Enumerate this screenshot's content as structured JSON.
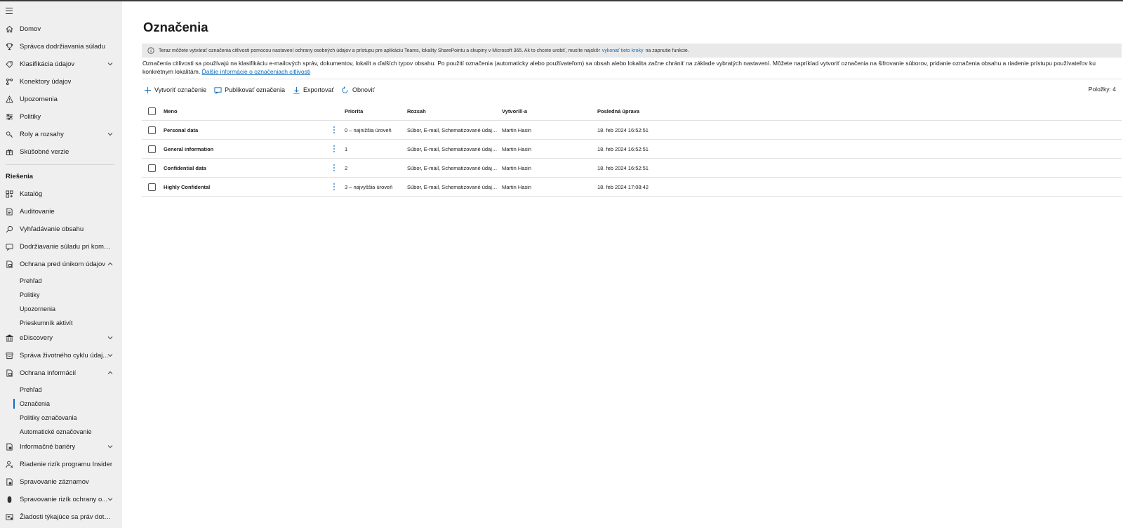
{
  "sidebar": {
    "items": [
      {
        "label": "Domov",
        "icon": "home-icon"
      },
      {
        "label": "Správca dodržiavania súladu",
        "icon": "trophy-icon"
      },
      {
        "label": "Klasifikácia údajov",
        "icon": "tag-icon",
        "expandable": true
      },
      {
        "label": "Konektory údajov",
        "icon": "connector-icon"
      },
      {
        "label": "Upozornenia",
        "icon": "warning-icon"
      },
      {
        "label": "Politiky",
        "icon": "sliders-icon"
      },
      {
        "label": "Roly a rozsahy",
        "icon": "key-icon",
        "expandable": true
      },
      {
        "label": "Skúšobné verzie",
        "icon": "gift-icon"
      }
    ],
    "section_title": "Riešenia",
    "solutions": [
      {
        "label": "Katalóg",
        "icon": "grid-icon"
      },
      {
        "label": "Auditovanie",
        "icon": "audit-icon"
      },
      {
        "label": "Vyhľadávanie obsahu",
        "icon": "search-icon"
      },
      {
        "label": "Dodržiavanie súladu pri komunik...",
        "icon": "chat-icon"
      },
      {
        "label": "Ochrana pred únikom údajov",
        "icon": "dlp-icon",
        "expanded": true,
        "children": [
          "Prehľad",
          "Politiky",
          "Upozornenia",
          "Prieskumník aktivít"
        ]
      },
      {
        "label": "eDiscovery",
        "icon": "building-icon",
        "expandable": true
      },
      {
        "label": "Správa životného cyklu údaj...",
        "icon": "archive-icon",
        "expandable": true
      },
      {
        "label": "Ochrana informácií",
        "icon": "lock-doc-icon",
        "expanded": true,
        "children": [
          "Prehľad",
          "Označenia",
          "Politiky označovania",
          "Automatické označovanie"
        ],
        "active_child": "Označenia"
      },
      {
        "label": "Informačné bariéry",
        "icon": "barrier-icon",
        "expandable": true
      },
      {
        "label": "Riadenie rizík programu Insider",
        "icon": "person-risk-icon"
      },
      {
        "label": "Spravovanie záznamov",
        "icon": "records-icon"
      },
      {
        "label": "Spravovanie rizík ochrany o...",
        "icon": "privacy-icon",
        "expandable": true
      },
      {
        "label": "Žiadosti týkajúce sa práv dotknut...",
        "icon": "request-icon"
      }
    ]
  },
  "main": {
    "title": "Označenia",
    "banner": {
      "text_before": "Teraz môžete vytvárať označenia citlivosti pomocou nastavení ochrany osobných údajov a prístupu pre aplikáciu Teams, lokality SharePointu a skupiny v Microsoft 365. Ak to chcete urobiť, musíte najskôr",
      "link": "vykonať tieto kroky",
      "text_after": "na zapnutie funkcie."
    },
    "description": "Označenia citlivosti sa používajú na klasifikáciu e-mailových správ, dokumentov, lokalít a ďalších typov obsahu. Po použití označenia (automaticky alebo používateľom) sa obsah alebo lokalita začne chrániť na základe vybratých nastavení. Môžete napríklad vytvoriť označenia na šifrovanie súborov, pridanie označenia obsahu a riadenie prístupu používateľov ku konkrétnym lokalitám.",
    "description_link": "Ďalšie informácie o označeniach citlivosti",
    "toolbar": {
      "create": "Vytvoriť označenie",
      "publish": "Publikovať označenia",
      "export": "Exportovať",
      "refresh": "Obnoviť"
    },
    "count": "Položky: 4",
    "columns": {
      "name": "Meno",
      "priority": "Priorita",
      "scope": "Rozsah",
      "created_by": "Vytvoril/-a",
      "modified": "Posledná úprava"
    },
    "rows": [
      {
        "name": "Personal data",
        "priority": "0 – najnižšia úroveň",
        "scope": "Súbor, E-mail, Schematizované údajov...",
        "created_by": "Martin Hasin",
        "modified": "18. feb 2024 16:52:51"
      },
      {
        "name": "General information",
        "priority": "1",
        "scope": "Súbor, E-mail, Schematizované údajov...",
        "created_by": "Martin Hasin",
        "modified": "18. feb 2024 16:52:51"
      },
      {
        "name": "Confidential data",
        "priority": "2",
        "scope": "Súbor, E-mail, Schematizované údajov...",
        "created_by": "Martin Hasin",
        "modified": "18. feb 2024 16:52:51"
      },
      {
        "name": "Highly Confidental",
        "priority": "3 – najvyššia úroveň",
        "scope": "Súbor, E-mail, Schematizované údajov...",
        "created_by": "Martin Hasin",
        "modified": "18. feb 2024 17:08:42"
      }
    ]
  },
  "colors": {
    "accent": "#0f6cbd",
    "sidebar_bg": "#efefef",
    "banner_bg": "#e9e9e9"
  }
}
